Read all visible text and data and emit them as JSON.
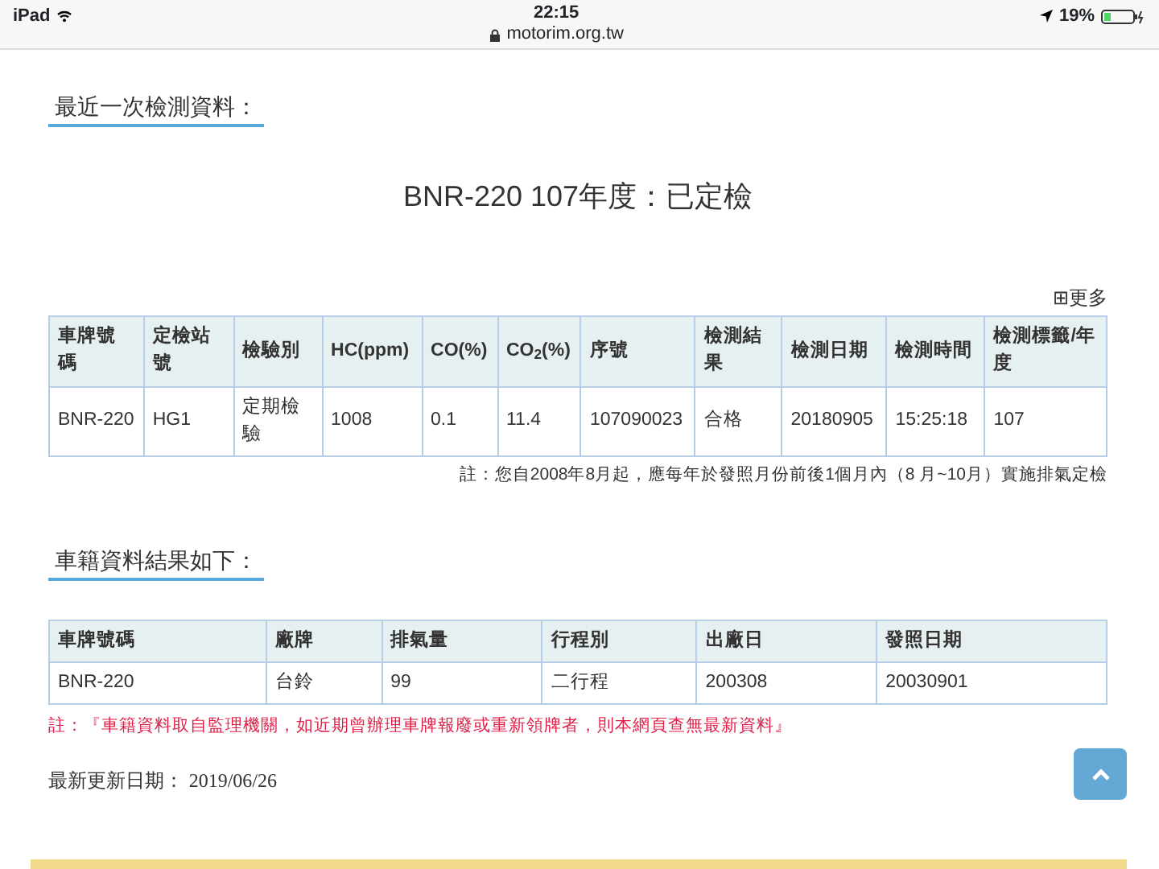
{
  "status_bar": {
    "device": "iPad",
    "time": "22:15",
    "url": "motorim.org.tw",
    "battery": "19%"
  },
  "inspection": {
    "heading": "最近一次檢測資料：",
    "title": "BNR-220 107年度：已定檢",
    "more": "⊞更多",
    "columns": [
      "車牌號碼",
      "定檢站號",
      "檢驗別",
      "HC(ppm)",
      "CO(%)",
      "CO$_{2}$(%)",
      "序號",
      "檢測結果",
      "檢測日期",
      "檢測時間",
      "檢測標籤/年度"
    ],
    "rows": [
      [
        "BNR-220",
        "HG1",
        "定期檢驗",
        "1008",
        "0.1",
        "11.4",
        "107090023",
        "合格",
        "20180905",
        "15:25:18",
        "107"
      ]
    ],
    "note": "註：您自2008年8月起，應每年於發照月份前後1個月內（8 月~10月）實施排氣定檢"
  },
  "registration": {
    "heading": "車籍資料結果如下：",
    "columns": [
      "車牌號碼",
      "廠牌",
      "排氣量",
      "行程別",
      "出廠日",
      "發照日期"
    ],
    "rows": [
      [
        "BNR-220",
        "台鈴",
        "99",
        "二行程",
        "200308",
        "20030901"
      ]
    ],
    "note": "註：『車籍資料取自監理機關，如近期曾辦理車牌報廢或重新領牌者，則本網頁查無最新資料』"
  },
  "updated": {
    "label": "最新更新日期：",
    "date": "2019/06/26"
  }
}
